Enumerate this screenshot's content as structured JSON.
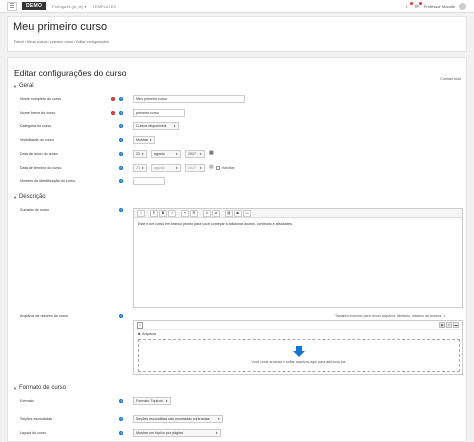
{
  "nav": {
    "logo": "DEMO",
    "language": "Português ‎(pt_br)‎ ▾",
    "templates": "TEMPLATES",
    "user_name": "Professor Moodle"
  },
  "header": {
    "title": "Meu primeiro curso",
    "breadcrumb": [
      "Painel",
      "Meus cursos",
      "primeiro curso",
      "Editar configurações"
    ]
  },
  "main": {
    "heading": "Editar configurações do curso",
    "collapse_all": "Contrair tudo"
  },
  "general": {
    "section_title": "Geral",
    "full_name_label": "Nome completo do curso",
    "full_name_value": "Meu primeiro curso",
    "short_name_label": "Nome breve do curso",
    "short_name_value": "primeiro curso",
    "category_label": "Categoria do curso",
    "category_value": "Cursos disponíveis",
    "visibility_label": "Visibilidade do curso",
    "visibility_value": "Mostrar",
    "start_label": "Data de início do curso",
    "start_day": "23",
    "start_month": "agosto",
    "start_year": "2017",
    "end_label": "Data de término do curso",
    "end_day": "23",
    "end_month": "agosto",
    "end_year": "2017",
    "enable_label": "Habilitar",
    "idnumber_label": "Número de identificação do curso",
    "idnumber_value": ""
  },
  "description": {
    "section_title": "Descrição",
    "summary_label": "Sumário do curso",
    "summary_text": "Este é um curso em branco pronto para você começar a adicionar alunos, conteúdo e atividades.",
    "files_label": "Arquivos de resumo do curso",
    "max_size": "Tamanho máximo para novos arquivos: ilimitado, máximo de anexos: 1",
    "folder_label": "Arquivos",
    "drop_text": "Você pode arrastar e soltar arquivos aqui para adicioná-los."
  },
  "format": {
    "section_title": "Formato de curso",
    "format_label": "Formato",
    "format_value": "Formato Tópicos",
    "hidden_label": "Seções escondidas",
    "hidden_value": "Seções escondidas são mostradas contraídas",
    "layout_label": "Layout do curso",
    "layout_value": "Mostrar um tópico por página"
  },
  "colors": {
    "required": "#c9302c",
    "help": "#1177d1",
    "logo_bg": "#333333"
  }
}
